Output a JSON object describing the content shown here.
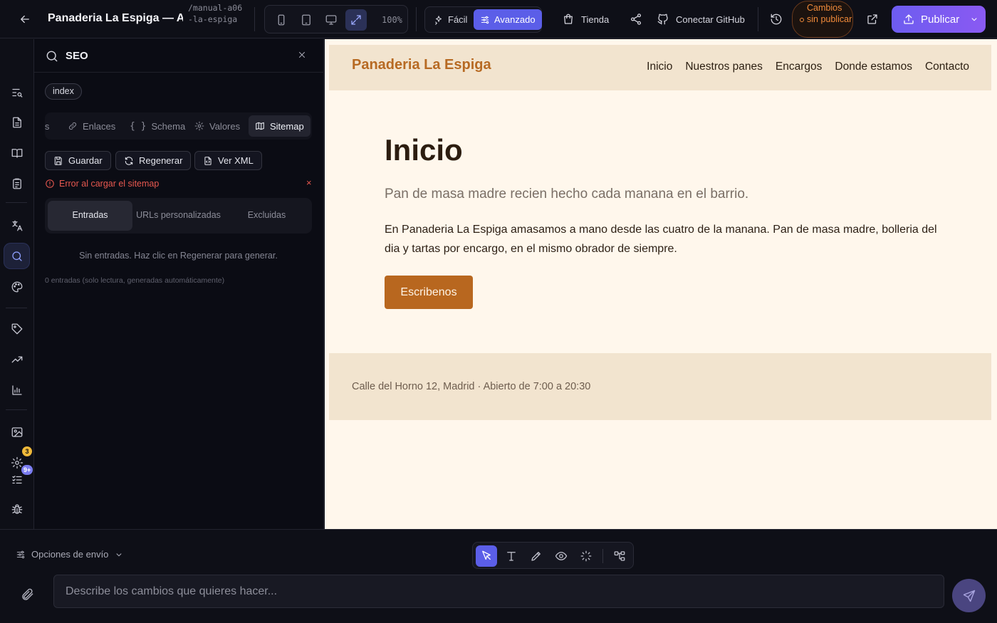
{
  "topbar": {
    "title": "Panaderia La Espiga — A...",
    "slug": "/manual-a06-la-espiga",
    "zoom": "100%",
    "mode_easy": "Fácil",
    "mode_advanced": "Avanzado",
    "store": "Tienda",
    "github": "Conectar GitHub",
    "unpublished": "Cambios sin publicar",
    "publish": "Publicar"
  },
  "rail": {
    "badge_settings": "3",
    "badge_tasks": "9+"
  },
  "seo_panel": {
    "title": "SEO",
    "page_chip": "index",
    "tabs": [
      "is",
      "Enlaces",
      "Schema",
      "Valores",
      "Sitemap"
    ],
    "actions": {
      "save": "Guardar",
      "regenerate": "Regenerar",
      "view_xml": "Ver XML"
    },
    "error": "Error al cargar el sitemap",
    "error_close": "×",
    "segments": [
      "Entradas",
      "URLs personalizadas",
      "Excluidas"
    ],
    "empty_message": "Sin entradas. Haz clic en Regenerar para generar.",
    "footnote": "0 entradas (solo lectura, generadas automáticamente)"
  },
  "preview": {
    "logo": "Panaderia La Espiga",
    "nav": [
      "Inicio",
      "Nuestros panes",
      "Encargos",
      "Donde estamos",
      "Contacto"
    ],
    "hero_title": "Inicio",
    "hero_subtitle": "Pan de masa madre recien hecho cada manana en el barrio.",
    "hero_body": "En Panaderia La Espiga amasamos a mano desde las cuatro de la manana. Pan de masa madre, bolleria del dia y tartas por encargo, en el mismo obrador de siempre.",
    "cta": "Escribenos",
    "footer": "Calle del Horno 12, Madrid · Abierto de 7:00 a 20:30"
  },
  "composer": {
    "send_options": "Opciones de envío",
    "placeholder": "Describe los cambios que quieres hacer..."
  },
  "colors": {
    "accent": "#5b5ee8",
    "publish": "#7a5cf0",
    "error": "#e8584f",
    "brand_bread": "#b8671f",
    "unpublished": "#f08a3a"
  },
  "icons": {
    "back": "arrow-left-icon",
    "devices": [
      "phone-icon",
      "tablet-icon",
      "desktop-icon",
      "expand-icon"
    ],
    "rail": [
      "search-list-icon",
      "file-icon",
      "book-icon",
      "clipboard-icon",
      "translate-icon",
      "search-icon",
      "palette-icon",
      "tag-icon",
      "trending-icon",
      "bar-chart-icon",
      "image-icon",
      "settings-icon",
      "checklist-icon",
      "bug-icon"
    ]
  }
}
